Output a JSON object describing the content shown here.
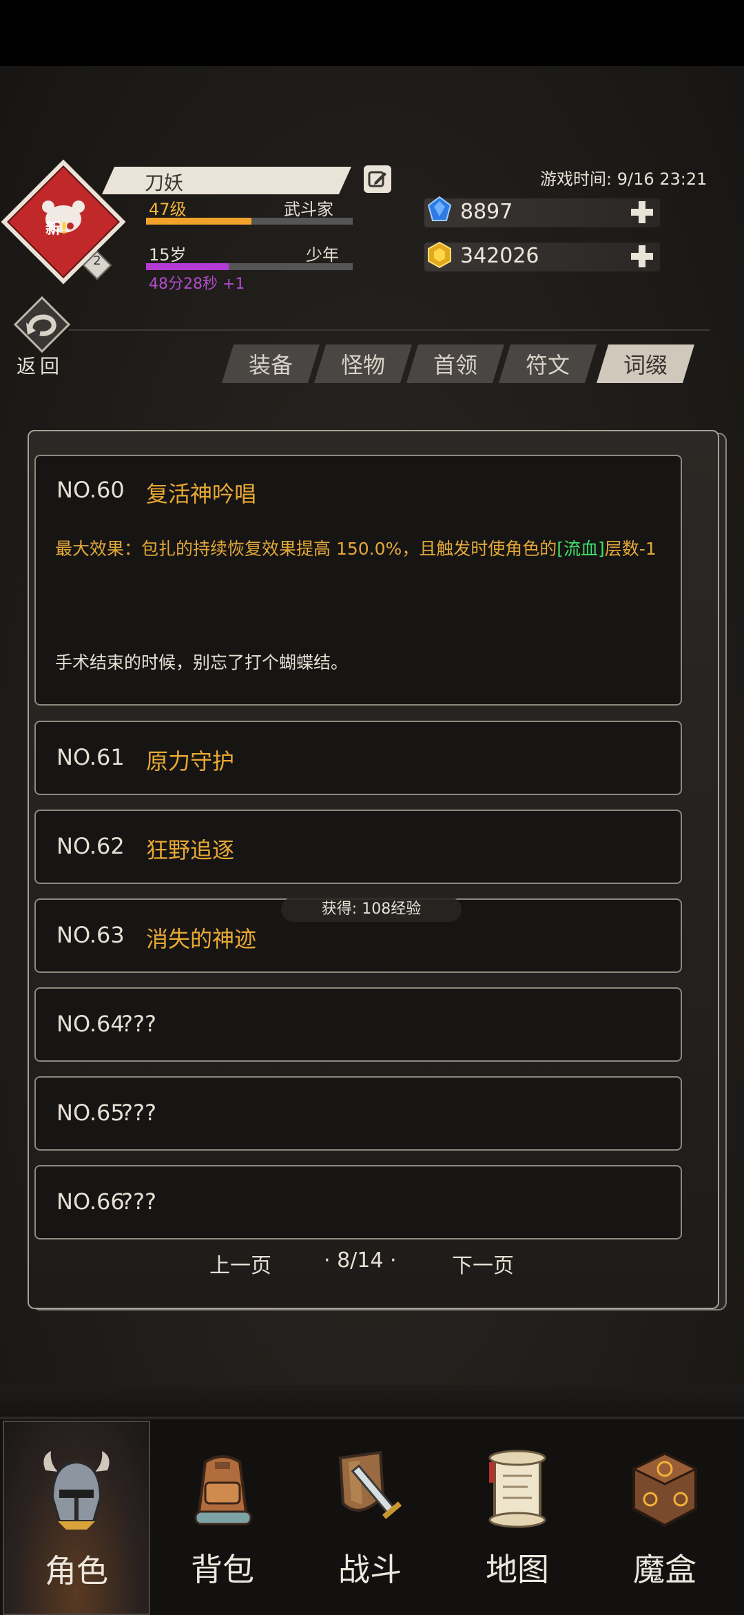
{
  "player": {
    "name": "刀妖",
    "level": "47级",
    "job": "武斗家",
    "xp_fraction": 0.51,
    "age": "15岁",
    "age_stage": "少年",
    "age_fraction": 0.4,
    "age_timer": "48分28秒 +1",
    "avatar_badge": "新",
    "avatar_badge_mark": "!",
    "avatar_level": "2"
  },
  "game_time": "游戏时间: 9/16 23:21",
  "resources": {
    "gems": "8897",
    "gold": "342026"
  },
  "return_label": "返回",
  "tabs": [
    {
      "label": "装备",
      "active": false
    },
    {
      "label": "怪物",
      "active": false
    },
    {
      "label": "首领",
      "active": false
    },
    {
      "label": "符文",
      "active": false
    },
    {
      "label": "词缀",
      "active": true
    }
  ],
  "entries": [
    {
      "no": "NO.60",
      "name": "复活神吟唱",
      "effect_prefix": "最大效果：包扎的持续恢复效果提高 150.0%，且触发时使角色的",
      "effect_highlight": "[流血]",
      "effect_suffix": "层数-1",
      "flavor": "手术结束的时候，别忘了打个蝴蝶结。"
    },
    {
      "no": "NO.61",
      "name": "原力守护"
    },
    {
      "no": "NO.62",
      "name": "狂野追逐"
    },
    {
      "no": "NO.63",
      "name": "消失的神迹"
    },
    {
      "no": "NO.64",
      "name": "???"
    },
    {
      "no": "NO.65",
      "name": "???"
    },
    {
      "no": "NO.66",
      "name": "???"
    }
  ],
  "toast": "获得: 108经验",
  "pager": {
    "prev": "上一页",
    "page": "8/14",
    "next": "下一页"
  },
  "nav": [
    {
      "label": "角色",
      "icon": "helmet-icon",
      "active": true
    },
    {
      "label": "背包",
      "icon": "backpack-icon",
      "active": false
    },
    {
      "label": "战斗",
      "icon": "sword-shield-icon",
      "active": false
    },
    {
      "label": "地图",
      "icon": "scroll-map-icon",
      "active": false
    },
    {
      "label": "魔盒",
      "icon": "magic-box-icon",
      "active": false
    }
  ],
  "colors": {
    "accent_gold": "#e8a935",
    "level_gold": "#f0b73a",
    "xp_bar": "#f1a22b",
    "age_bar": "#b43bd3",
    "highlight_green": "#3fe06a"
  }
}
